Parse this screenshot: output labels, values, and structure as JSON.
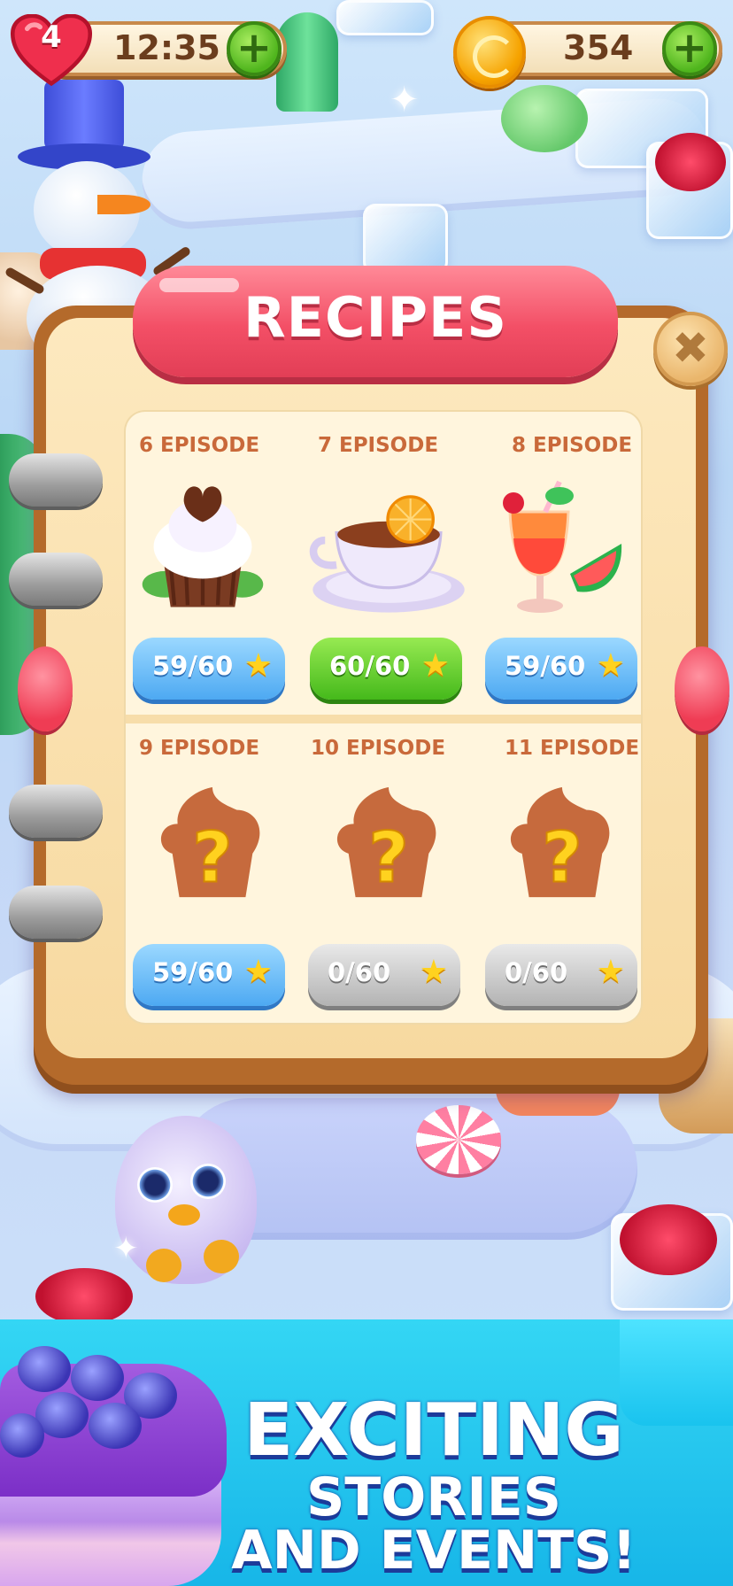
{
  "hud": {
    "lives": "4",
    "timer": "12:35",
    "coins": "354",
    "plus_label": "+"
  },
  "panel": {
    "title": "RECIPES",
    "close_label": "✖"
  },
  "episodes": [
    {
      "label": "6 EPISODE",
      "stars": "59/60",
      "state": "blue",
      "icon": "cupcake-icon"
    },
    {
      "label": "7 EPISODE",
      "stars": "60/60",
      "state": "green",
      "icon": "tea-cup-icon"
    },
    {
      "label": "8 EPISODE",
      "stars": "59/60",
      "state": "blue",
      "icon": "cocktail-icon"
    },
    {
      "label": "9 EPISODE",
      "stars": "59/60",
      "state": "blue",
      "icon": "locked-recipe-icon"
    },
    {
      "label": "10 EPISODE",
      "stars": "0/60",
      "state": "gray",
      "icon": "locked-recipe-icon"
    },
    {
      "label": "11 EPISODE",
      "stars": "0/60",
      "state": "gray",
      "icon": "locked-recipe-icon"
    }
  ],
  "banner": {
    "line1": "EXCITING",
    "line2": "STORIES",
    "line3": "AND EVENTS!"
  },
  "icons": {
    "star": "★",
    "question": "?"
  },
  "colors": {
    "ribbon": "#f34f66",
    "book_frame": "#b46a2b",
    "pill_blue": "#4da9f2",
    "pill_green": "#45b91b",
    "pill_gray": "#b3b3b3",
    "banner": "#17b6e8"
  }
}
